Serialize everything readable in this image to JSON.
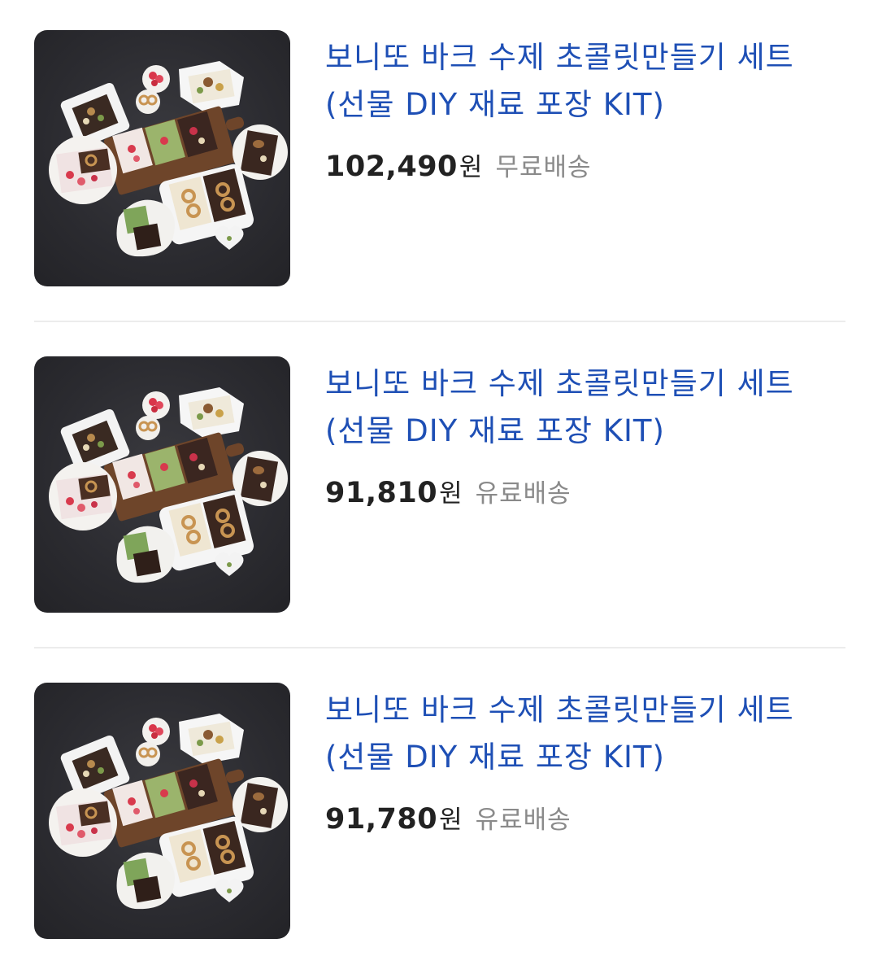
{
  "products": [
    {
      "title_line1": "보니또 바크 수제 초콜릿만들기 세트",
      "title_line2": "(선물 DIY 재료 포장 KIT)",
      "price": "102,490",
      "currency": "원",
      "shipping": "무료배송",
      "image": "chocolate-bark-kit-photo"
    },
    {
      "title_line1": "보니또 바크 수제 초콜릿만들기 세트",
      "title_line2": "(선물 DIY 재료 포장 KIT)",
      "price": "91,810",
      "currency": "원",
      "shipping": "유료배송",
      "image": "chocolate-bark-kit-photo"
    },
    {
      "title_line1": "보니또 바크 수제 초콜릿만들기 세트",
      "title_line2": "(선물 DIY 재료 포장 KIT)",
      "price": "91,780",
      "currency": "원",
      "shipping": "유료배송",
      "image": "chocolate-bark-kit-photo"
    }
  ],
  "colors": {
    "title": "#1e4fb5",
    "price": "#222222",
    "shipping": "#8a8a8a",
    "divider": "#ececec"
  }
}
